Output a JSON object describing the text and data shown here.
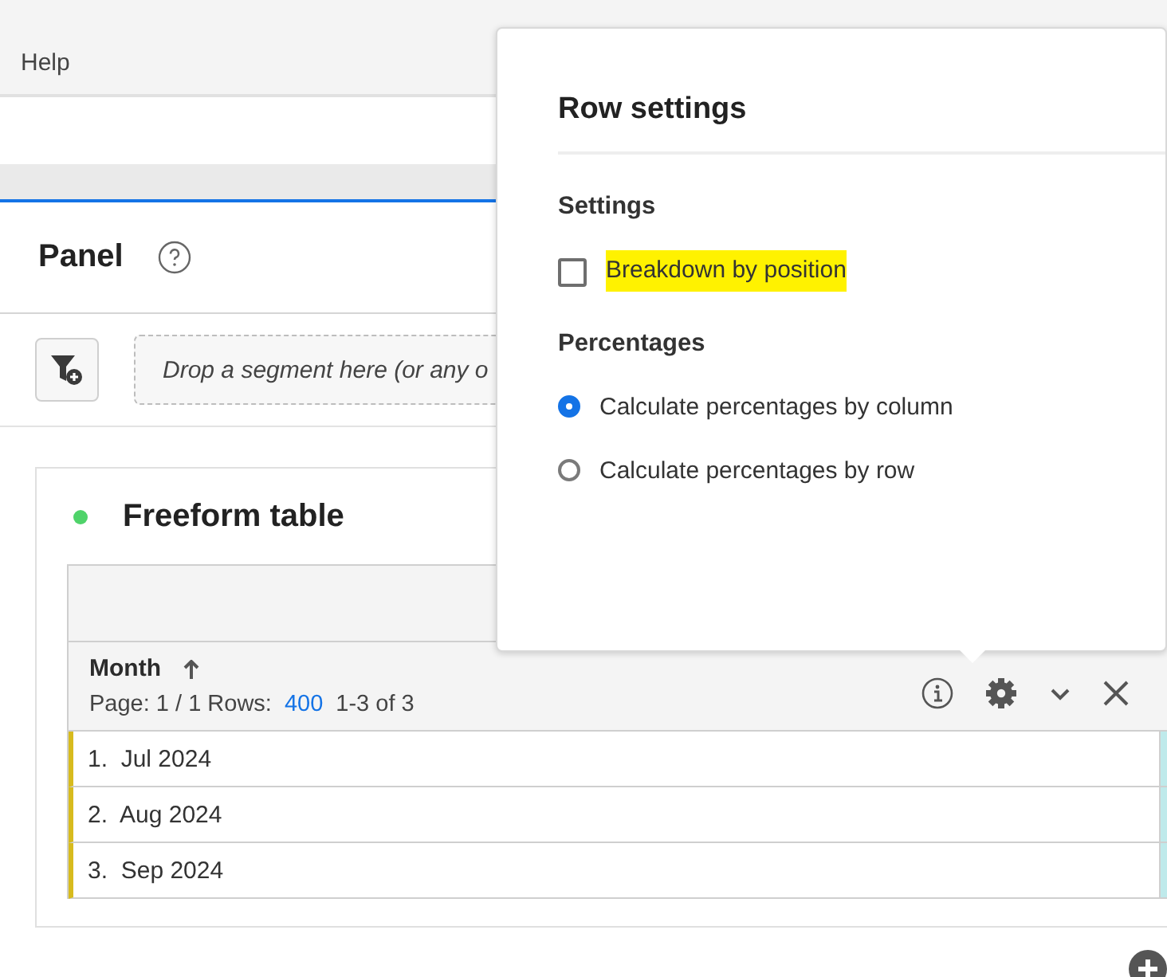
{
  "menu": [
    {
      "label": "Help"
    }
  ],
  "panel": {
    "title": "Panel"
  },
  "segment_drop": {
    "placeholder": "Drop a segment here (or any o"
  },
  "freeform": {
    "title": "Freeform table",
    "color": "#4fd36a",
    "table": {
      "column": {
        "label": "Month",
        "sorted_ascending": true
      },
      "pagination": {
        "page_label": "Page: 1 / 1 Rows:",
        "rows_value": "400",
        "range": "1-3 of 3"
      },
      "rows": [
        {
          "number": "1.",
          "label": "Jul 2024"
        },
        {
          "number": "2.",
          "label": "Aug 2024"
        },
        {
          "number": "3.",
          "label": "Sep 2024"
        }
      ]
    }
  },
  "popover": {
    "title": "Row settings",
    "sections": [
      {
        "heading": "Settings",
        "options": [
          {
            "kind": "checkbox",
            "label": "Breakdown by position",
            "checked": false,
            "highlighted": true
          }
        ]
      },
      {
        "heading": "Percentages",
        "options": [
          {
            "kind": "radio",
            "label": "Calculate percentages by column",
            "selected": true,
            "highlighted": false
          },
          {
            "kind": "radio",
            "label": "Calculate percentages by row",
            "selected": false,
            "highlighted": false
          }
        ]
      }
    ]
  }
}
